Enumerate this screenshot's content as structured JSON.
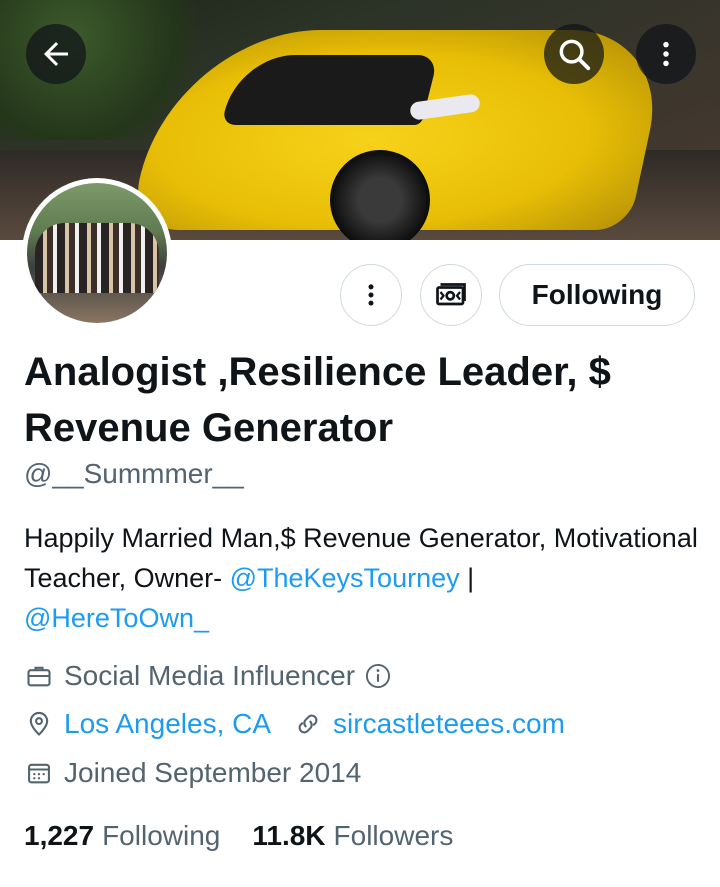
{
  "header": {
    "back_icon": "arrow-left-icon",
    "search_icon": "search-icon",
    "more_icon": "more-vertical-icon"
  },
  "actions": {
    "more_icon": "more-vertical-icon",
    "subscribe_icon": "money-icon",
    "follow_label": "Following"
  },
  "profile": {
    "display_name": "Analogist ,Resilience Leader, $ Revenue Generator",
    "handle": "@__Summmer__",
    "bio_text": "Happily Married Man,$ Revenue Generator, Motivational Teacher, Owner- ",
    "bio_link_1": "@TheKeysTourney",
    "bio_separator": " |",
    "bio_link_2": "@HereToOwn_",
    "category": "Social Media Influencer",
    "location": "Los Angeles, CA",
    "website": "sircastleteees.com",
    "joined": "Joined September 2014"
  },
  "stats": {
    "following_count": "1,227",
    "following_label": "Following",
    "followers_count": "11.8K",
    "followers_label": "Followers"
  },
  "colors": {
    "link": "#1d9bf0",
    "secondary_text": "#536471",
    "primary_text": "#0f1419",
    "border": "#cfd9de"
  }
}
